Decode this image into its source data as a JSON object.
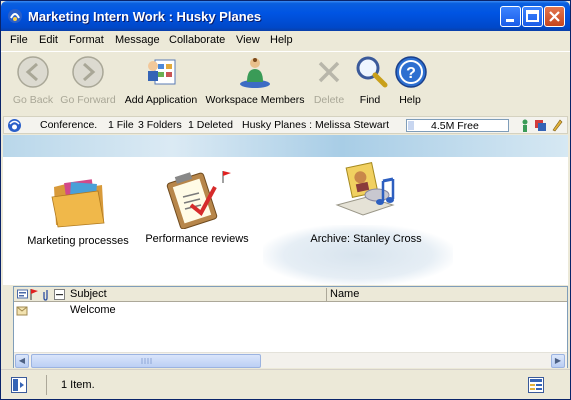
{
  "window": {
    "title": "Marketing Intern Work : Husky Planes",
    "controls": [
      "minimize",
      "maximize",
      "close"
    ]
  },
  "menu": [
    "File",
    "Edit",
    "Format",
    "Message",
    "Collaborate",
    "View",
    "Help"
  ],
  "toolbar": {
    "go_back": "Go Back",
    "go_forward": "Go Forward",
    "add_application": "Add Application",
    "workspace_members": "Workspace Members",
    "delete": "Delete",
    "find": "Find",
    "help": "Help"
  },
  "infobar": {
    "conference": "Conference.",
    "files": "1 File",
    "folders": "3 Folders",
    "deleted": "1 Deleted",
    "location": "Husky Planes : Melissa Stewart",
    "free": "4.5M Free"
  },
  "workspace_items": [
    {
      "label": "Marketing processes",
      "icon": "folder-icon"
    },
    {
      "label": "Performance reviews",
      "icon": "clipboard-icon"
    },
    {
      "label": "Archive: Stanley Cross",
      "icon": "archive-media-icon"
    }
  ],
  "list": {
    "columns": {
      "subject": "Subject",
      "name": "Name"
    },
    "rows": [
      {
        "subject": "Welcome",
        "name": ""
      }
    ]
  },
  "status": {
    "items": "1 Item."
  },
  "colors": {
    "titlebar": "#0054e3",
    "window_bg": "#ece9d8",
    "accent": "#316ac5"
  }
}
